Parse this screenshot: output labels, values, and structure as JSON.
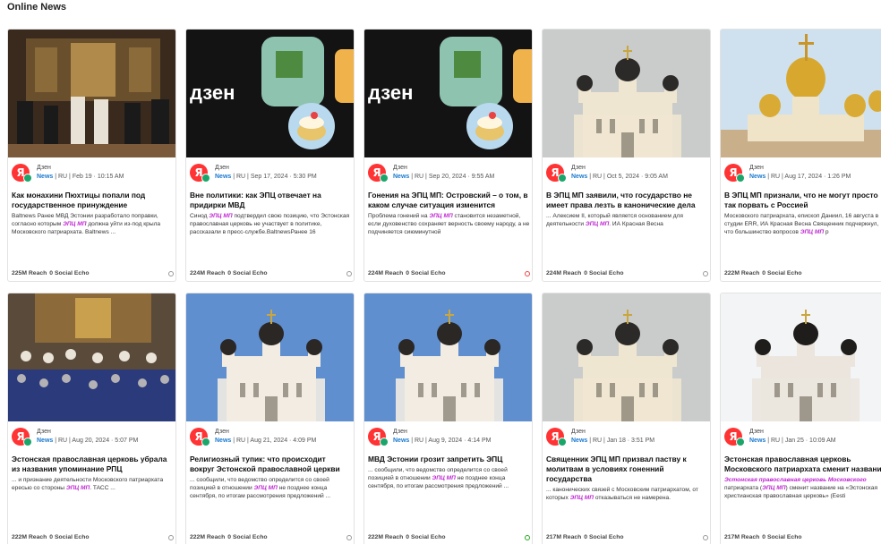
{
  "page_title": "Online News",
  "colors": {
    "highlight": "#c026d3",
    "news_label": "#1a7ad0",
    "yandex": "#ff3333"
  },
  "cards": [
    {
      "image": "church-interior-nuns",
      "source": "Дзен",
      "label": "News",
      "meta": " | RU | Feb 19 · 10:15 AM",
      "headline": "Как монахини Пюхтицы попали под государственное принуждение",
      "snippet": [
        {
          "t": "Baltnews Ранее МВД Эстонии разработало поправки, согласно которым "
        },
        {
          "t": "ЭПЦ МП",
          "hl": true
        },
        {
          "t": " должна уйти из-под крыла Московского патриархата. Baltnews ..."
        }
      ],
      "reach": "225M Reach",
      "echo": "0 Social Echo",
      "status": "neutral"
    },
    {
      "image": "dzen-banner",
      "source": "Дзен",
      "label": "News",
      "meta": " | RU | Sep 17, 2024 · 5:30 PM",
      "headline": "Вне политики: как ЭПЦ отвечает на придирки МВД",
      "snippet": [
        {
          "t": "Синод "
        },
        {
          "t": "ЭПЦ МП",
          "hl": true
        },
        {
          "t": " подтвердил свою позицию, что Эстонская православная церковь не участвует в политике, рассказали в пресс-службе.BaltnewsРанее 16"
        }
      ],
      "reach": "224M Reach",
      "echo": "0 Social Echo",
      "status": "neutral"
    },
    {
      "image": "dzen-banner",
      "source": "Дзен",
      "label": "News",
      "meta": " | RU | Sep 20, 2024 · 9:55 AM",
      "headline": "Гонения на ЭПЦ МП: Островский – о том, в каком случае ситуация изменится",
      "snippet": [
        {
          "t": "Проблема гонений на "
        },
        {
          "t": "ЭПЦ МП",
          "hl": true
        },
        {
          "t": " становится незаметной, если духовенство сохраняет верность своему народу, а не подчиняется сиюминутной"
        }
      ],
      "reach": "224M Reach",
      "echo": "0 Social Echo",
      "status": "red"
    },
    {
      "image": "cathedral-cloudy",
      "source": "Дзен",
      "label": "News",
      "meta": " | RU | Oct 5, 2024 · 9:05 AM",
      "headline": "В ЭПЦ МП заявили, что государство не имеет права лезть в канонические дела",
      "snippet": [
        {
          "t": "... Алексием II, который является основанием для деятельности "
        },
        {
          "t": "ЭПЦ МП",
          "hl": true
        },
        {
          "t": ". ИА Красная Весна"
        }
      ],
      "reach": "224M Reach",
      "echo": "0 Social Echo",
      "status": "neutral"
    },
    {
      "image": "golden-domes",
      "source": "Дзен",
      "label": "News",
      "meta": " | RU | Aug 17, 2024 · 1:26 PM",
      "headline": "В ЭПЦ МП признали, что не могут просто так порвать с Россией",
      "snippet": [
        {
          "t": "Московского патриархата, епископ Даниил, 16 августа в студии ERR, ИА Красная Весна Священник подчеркнул, что большинство вопросов "
        },
        {
          "t": "ЭПЦ МП",
          "hl": true
        },
        {
          "t": " р"
        }
      ],
      "reach": "222M Reach",
      "echo": "0 Social Echo",
      "status": "neutral"
    },
    {
      "image": "church-crowd",
      "source": "Дзен",
      "label": "News",
      "meta": " | RU | Aug 20, 2024 · 5:07 PM",
      "headline": "Эстонская православная церковь убрала из названия упоминание РПЦ",
      "snippet": [
        {
          "t": "... и признание деятельности Московского патриархата ересью со стороны "
        },
        {
          "t": "ЭПЦ МП",
          "hl": true
        },
        {
          "t": ". ТАСС ..."
        }
      ],
      "reach": "222M Reach",
      "echo": "0 Social Echo",
      "status": "neutral"
    },
    {
      "image": "cathedral-blue",
      "source": "Дзен",
      "label": "News",
      "meta": " | RU | Aug 21, 2024 · 4:09 PM",
      "headline": "Религиозный тупик: что происходит вокруг Эстонской православной церкви",
      "snippet": [
        {
          "t": "... сообщили, что ведомство определится со своей позицией в отношении "
        },
        {
          "t": "ЭПЦ МП",
          "hl": true
        },
        {
          "t": " не позднее конца сентября, по итогам рассмотрения предложений ..."
        }
      ],
      "reach": "222M Reach",
      "echo": "0 Social Echo",
      "status": "neutral"
    },
    {
      "image": "cathedral-blue",
      "source": "Дзен",
      "label": "News",
      "meta": " | RU | Aug 9, 2024 · 4:14 PM",
      "headline": "МВД Эстонии грозит запретить ЭПЦ",
      "snippet": [
        {
          "t": "... сообщили, что ведомство определится со своей позицией в отношении "
        },
        {
          "t": "ЭПЦ МП",
          "hl": true
        },
        {
          "t": " не позднее конца сентября, по итогам рассмотрения предложений ..."
        }
      ],
      "reach": "222M Reach",
      "echo": "0 Social Echo",
      "status": "green"
    },
    {
      "image": "cathedral-cloudy",
      "source": "Дзен",
      "label": "News",
      "meta": " | RU | Jan 18 · 3:51 PM",
      "headline": "Священник ЭПЦ МП призвал паству к молитвам в условиях гоненний государства",
      "snippet": [
        {
          "t": "... канонических связей с Московским патриархатом, от которых "
        },
        {
          "t": "ЭПЦ МП",
          "hl": true
        },
        {
          "t": " отказываться не намерена."
        }
      ],
      "reach": "217M Reach",
      "echo": "0 Social Echo",
      "status": "neutral"
    },
    {
      "image": "cathedral-white",
      "source": "Дзен",
      "label": "News",
      "meta": " | RU | Jan 25 · 10:09 AM",
      "headline": "Эстонская православная церковь Московского патриархата сменит название",
      "snippet": [
        {
          "t": "Эстонская православная церковь Московского",
          "hl": true
        },
        {
          "t": " патриархата ("
        },
        {
          "t": "ЭПЦ МП",
          "hl": true
        },
        {
          "t": ") сменит название на «Эстонская христианская православная церковь» (Eesti"
        }
      ],
      "reach": "217M Reach",
      "echo": "0 Social Echo",
      "status": "neutral"
    }
  ]
}
